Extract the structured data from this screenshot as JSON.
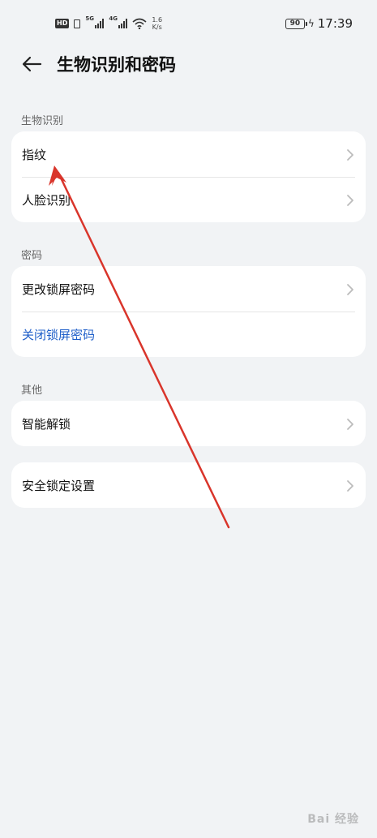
{
  "status_bar": {
    "hd": "HD",
    "sim1_tag": "5G",
    "sim2_tag": "4G",
    "speed_value": "1.6",
    "speed_unit": "K/s",
    "battery": "90",
    "time": "17:39"
  },
  "header": {
    "title": "生物识别和密码"
  },
  "sections": {
    "biometric": {
      "label": "生物识别",
      "items": [
        {
          "label": "指纹"
        },
        {
          "label": "人脸识别"
        }
      ]
    },
    "password": {
      "label": "密码",
      "items": [
        {
          "label": "更改锁屏密码"
        },
        {
          "label": "关闭锁屏密码"
        }
      ]
    },
    "other": {
      "label": "其他",
      "items": [
        {
          "label": "智能解锁"
        }
      ]
    },
    "security": {
      "items": [
        {
          "label": "安全锁定设置"
        }
      ]
    }
  },
  "watermark": "Bai 经验",
  "colors": {
    "background": "#f1f3f5",
    "card": "#ffffff",
    "link": "#1f5fc9",
    "annotation_arrow": "#d9352b"
  }
}
